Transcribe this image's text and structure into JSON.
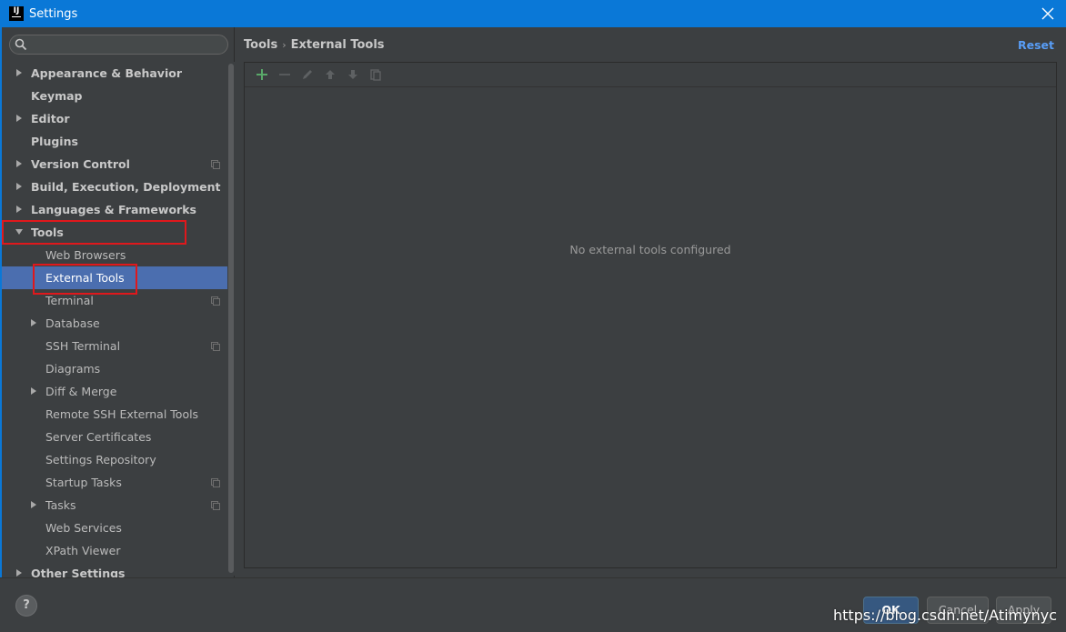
{
  "window": {
    "title": "Settings",
    "app_icon": "IJ"
  },
  "search": {
    "placeholder": "",
    "value": ""
  },
  "sidebar": {
    "items": [
      {
        "label": "Appearance & Behavior",
        "level": 0,
        "expandable": true,
        "expanded": false,
        "project_icon": false
      },
      {
        "label": "Keymap",
        "level": 0,
        "expandable": false,
        "project_icon": false
      },
      {
        "label": "Editor",
        "level": 0,
        "expandable": true,
        "expanded": false,
        "project_icon": false
      },
      {
        "label": "Plugins",
        "level": 0,
        "expandable": false,
        "project_icon": false
      },
      {
        "label": "Version Control",
        "level": 0,
        "expandable": true,
        "expanded": false,
        "project_icon": true
      },
      {
        "label": "Build, Execution, Deployment",
        "level": 0,
        "expandable": true,
        "expanded": false,
        "project_icon": false
      },
      {
        "label": "Languages & Frameworks",
        "level": 0,
        "expandable": true,
        "expanded": false,
        "project_icon": false
      },
      {
        "label": "Tools",
        "level": 0,
        "expandable": true,
        "expanded": true,
        "project_icon": false
      },
      {
        "label": "Web Browsers",
        "level": 1,
        "expandable": false,
        "project_icon": false
      },
      {
        "label": "External Tools",
        "level": 1,
        "expandable": false,
        "selected": true,
        "project_icon": false
      },
      {
        "label": "Terminal",
        "level": 1,
        "expandable": false,
        "project_icon": true
      },
      {
        "label": "Database",
        "level": 1,
        "expandable": true,
        "expanded": false,
        "project_icon": false
      },
      {
        "label": "SSH Terminal",
        "level": 1,
        "expandable": false,
        "project_icon": true
      },
      {
        "label": "Diagrams",
        "level": 1,
        "expandable": false,
        "project_icon": false
      },
      {
        "label": "Diff & Merge",
        "level": 1,
        "expandable": true,
        "expanded": false,
        "project_icon": false
      },
      {
        "label": "Remote SSH External Tools",
        "level": 1,
        "expandable": false,
        "project_icon": false
      },
      {
        "label": "Server Certificates",
        "level": 1,
        "expandable": false,
        "project_icon": false
      },
      {
        "label": "Settings Repository",
        "level": 1,
        "expandable": false,
        "project_icon": false
      },
      {
        "label": "Startup Tasks",
        "level": 1,
        "expandable": false,
        "project_icon": true
      },
      {
        "label": "Tasks",
        "level": 1,
        "expandable": true,
        "expanded": false,
        "project_icon": true
      },
      {
        "label": "Web Services",
        "level": 1,
        "expandable": false,
        "project_icon": false
      },
      {
        "label": "XPath Viewer",
        "level": 1,
        "expandable": false,
        "project_icon": false
      },
      {
        "label": "Other Settings",
        "level": 0,
        "expandable": true,
        "expanded": false,
        "project_icon": false
      }
    ]
  },
  "content": {
    "breadcrumb": [
      "Tools",
      "External Tools"
    ],
    "breadcrumb_separator": "›",
    "reset_label": "Reset",
    "toolbar": {
      "icons": [
        "plus-icon",
        "minus-icon",
        "edit-icon",
        "arrow-up-icon",
        "arrow-down-icon",
        "copy-icon"
      ]
    },
    "empty_message": "No external tools configured"
  },
  "footer": {
    "help_label": "?",
    "ok_label": "OK",
    "cancel_label": "Cancel",
    "apply_label": "Apply"
  },
  "watermark": "https://blog.csdn.net/Atimynyc",
  "colors": {
    "titlebar": "#0a78d7",
    "background": "#3c3f41",
    "selection": "#4b6eaf",
    "link": "#589df6",
    "add": "#59a869",
    "annotation": "#e0181c"
  }
}
